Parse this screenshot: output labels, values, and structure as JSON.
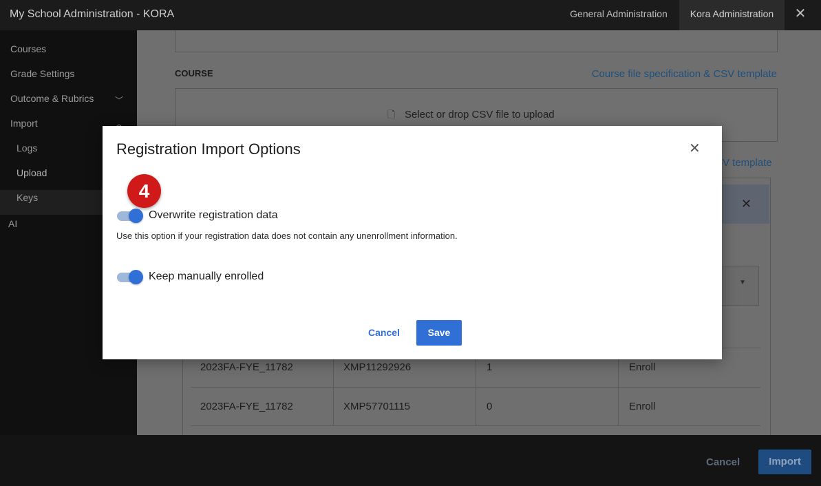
{
  "topbar": {
    "title": "My School Administration - KORA",
    "nav": [
      "General Administration",
      "Kora Administration"
    ],
    "close_icon": "close-icon"
  },
  "sidebar": {
    "items": [
      {
        "label": "Courses"
      },
      {
        "label": "Grade Settings"
      },
      {
        "label": "Outcome & Rubrics",
        "chevron": "chevron-down-icon"
      },
      {
        "label": "Import",
        "chevron": "chevron-up-icon"
      },
      {
        "label": "Logs"
      },
      {
        "label": "Upload",
        "active": true
      },
      {
        "label": "Keys"
      },
      {
        "label": "AI"
      }
    ]
  },
  "main": {
    "course_label": "COURSE",
    "course_spec_link": "Course file specification & CSV template",
    "drop_text": "Select or drop CSV file to upload",
    "second_spec_link": "SV template",
    "table_rows": [
      [
        "2023FA-FYE_11782",
        "XMP11292926",
        "1",
        "Enroll"
      ],
      [
        "2023FA-FYE_11782",
        "XMP57701115",
        "0",
        "Enroll"
      ]
    ]
  },
  "footer": {
    "cancel_label": "Cancel",
    "import_label": "Import"
  },
  "modal": {
    "title": "Registration Import Options",
    "step_badge": "4",
    "overwrite": {
      "label": "Overwrite registration data",
      "enabled": true
    },
    "helper_text": "Use this option if your registration data does not contain any unenrollment information.",
    "keep_manual": {
      "label": "Keep manually enrolled",
      "enabled": true
    },
    "cancel_label": "Cancel",
    "save_label": "Save"
  },
  "colors": {
    "accent": "#2f6fd6",
    "badge": "#d01a1a",
    "link": "#1f4f7a"
  }
}
